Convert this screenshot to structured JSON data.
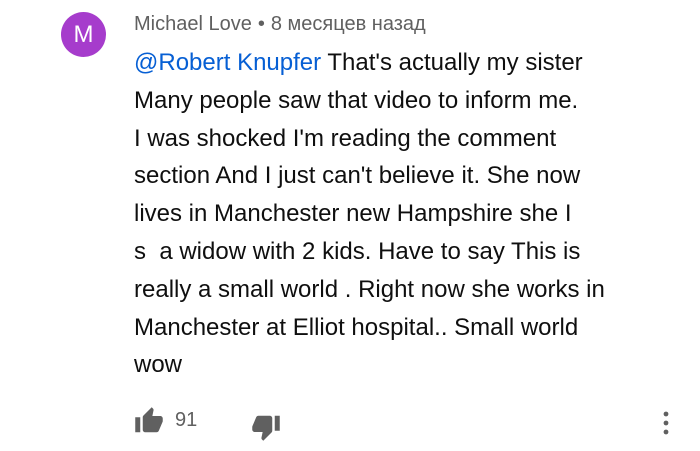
{
  "comment": {
    "avatar_letter": "M",
    "avatar_color": "#a63ccc",
    "author": "Michael Love",
    "separator": "•",
    "timestamp": "8 месяцев назад",
    "mention": "@Robert Knupfer",
    "lines": [
      " That's actually my sister",
      "Many people saw that video to inform me.",
      "I was shocked I'm reading the comment",
      "section And I just can't believe it. She now",
      "lives in Manchester new Hampshire she I",
      "s  a widow with 2 kids. Have to say This is",
      "really a small world . Right now she works in",
      "Manchester at Elliot hospital.. Small world",
      "wow"
    ],
    "likes": "91",
    "colors": {
      "text": "#0f0f0f",
      "secondary": "#606060",
      "mention": "#065fd4"
    }
  },
  "icons": {
    "like": "thumb-up-icon",
    "dislike": "thumb-down-icon",
    "more": "more-vertical-icon"
  }
}
